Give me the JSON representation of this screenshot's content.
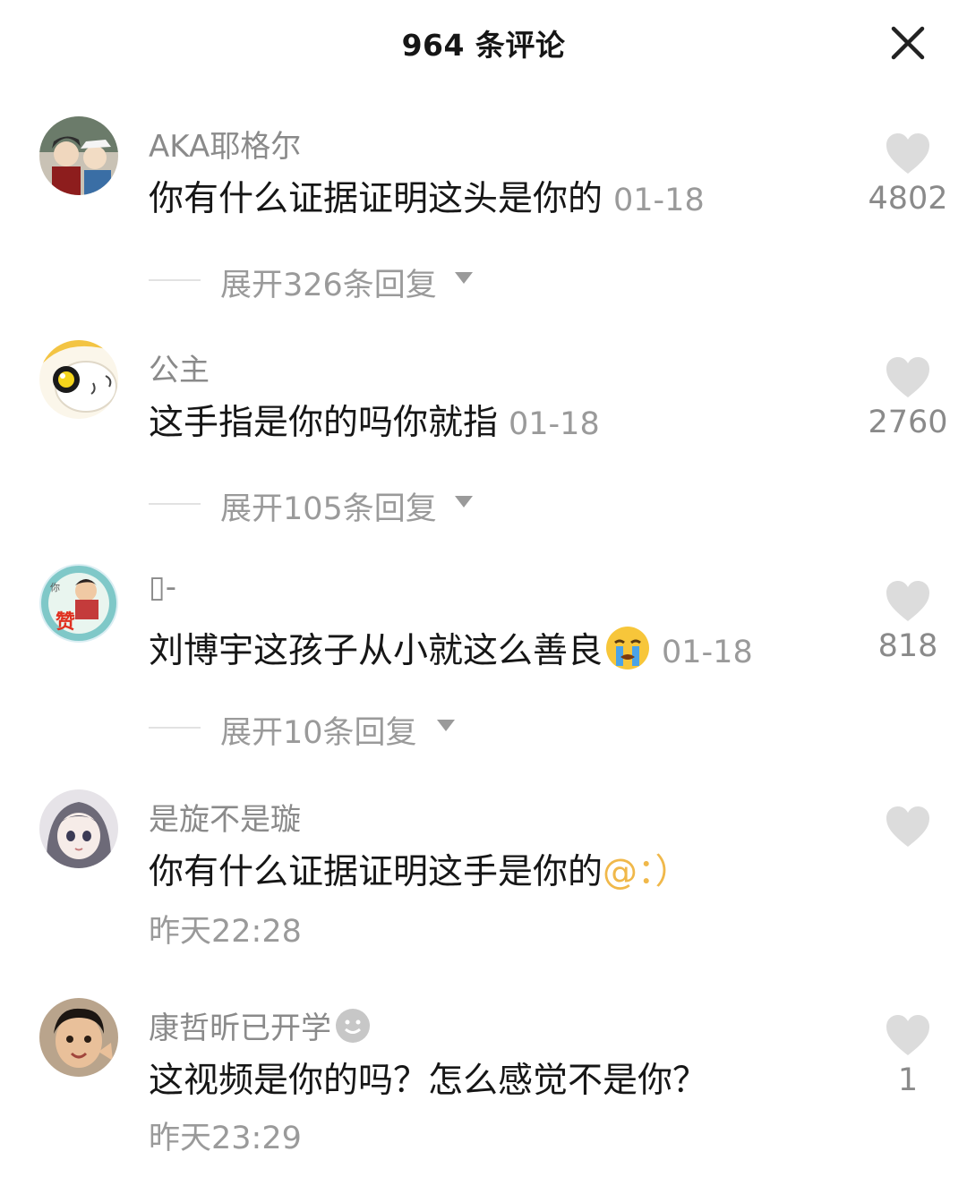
{
  "header": {
    "title": "964 条评论"
  },
  "comments": [
    {
      "username": "AKA耶格尔",
      "text": "你有什么证据证明这头是你的",
      "time": "01-18",
      "likes": "4802",
      "expand_label": "展开326条回复"
    },
    {
      "username": "公主",
      "text": "这手指是你的吗你就指",
      "time": "01-18",
      "likes": "2760",
      "expand_label": "展开105条回复"
    },
    {
      "username": "▯-",
      "text": "刘博宇这孩子从小就这么善良",
      "emoji": "crying-face-emoji",
      "time": "01-18",
      "likes": "818",
      "expand_label": "展开10条回复"
    },
    {
      "username": "是旋不是璇",
      "text": "你有什么证据证明这手是你的",
      "mention": "@：）",
      "time": "昨天22:28",
      "likes": ""
    },
    {
      "username": "康哲昕已开学",
      "username_emoji": "smiling-face-emoji",
      "text": "这视频是你的吗？怎么感觉不是你？",
      "time": "昨天23:29",
      "likes": "1"
    }
  ],
  "colors": {
    "primary_text": "#161616",
    "secondary_text": "#8a8a8a",
    "mention": "#f0b84a",
    "heart": "#dcdcdc"
  }
}
